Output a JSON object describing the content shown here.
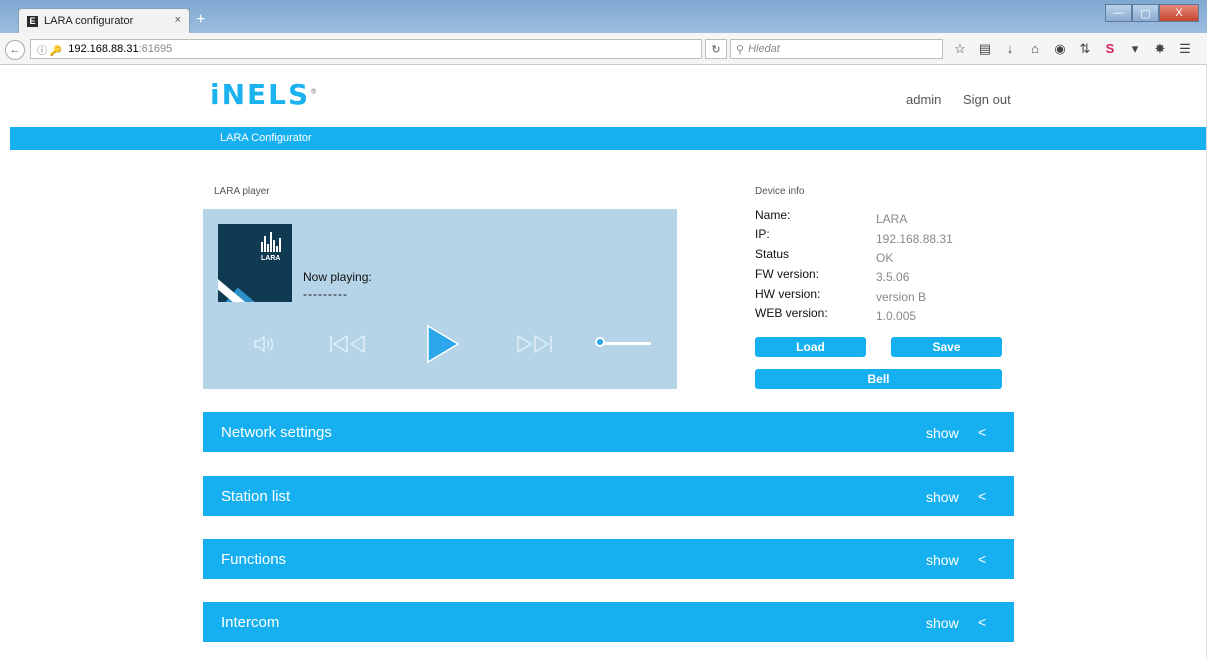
{
  "browser": {
    "tab_title": "LARA configurator",
    "tab_icon": "E",
    "tab_close": "×",
    "new_tab": "+",
    "url_host": "192.168.88.31",
    "url_port": ":61695",
    "search_placeholder": "Hledat",
    "window_buttons": [
      "—",
      "▢",
      "X"
    ]
  },
  "header": {
    "logo_text": "iNELS",
    "logo_mark": "®",
    "user": "admin",
    "sign_out": "Sign out"
  },
  "nav": {
    "title": "LARA Configurator"
  },
  "player": {
    "section_label": "LARA player",
    "album_text": "LARA",
    "now_playing_label": "Now playing:",
    "now_playing_value": "---------",
    "volume_level": 0
  },
  "device_info": {
    "section_label": "Device info",
    "rows": [
      {
        "key": "Name:",
        "value": "LARA"
      },
      {
        "key": "IP:",
        "value": "192.168.88.31"
      },
      {
        "key": "Status",
        "value": "OK"
      },
      {
        "key": "FW version:",
        "value": "3.5.06"
      },
      {
        "key": "HW version:",
        "value": "version B"
      },
      {
        "key": "WEB version:",
        "value": "1.0.005"
      }
    ],
    "load_label": "Load",
    "save_label": "Save",
    "bell_label": "Bell"
  },
  "sections": [
    {
      "title": "Network settings",
      "action": "show",
      "caret": "<"
    },
    {
      "title": "Station list",
      "action": "show",
      "caret": "<"
    },
    {
      "title": "Functions",
      "action": "show",
      "caret": "<"
    },
    {
      "title": "Intercom",
      "action": "show",
      "caret": "<"
    }
  ],
  "colors": {
    "accent": "#16b0f0",
    "player_bg": "#b5d4e8"
  }
}
